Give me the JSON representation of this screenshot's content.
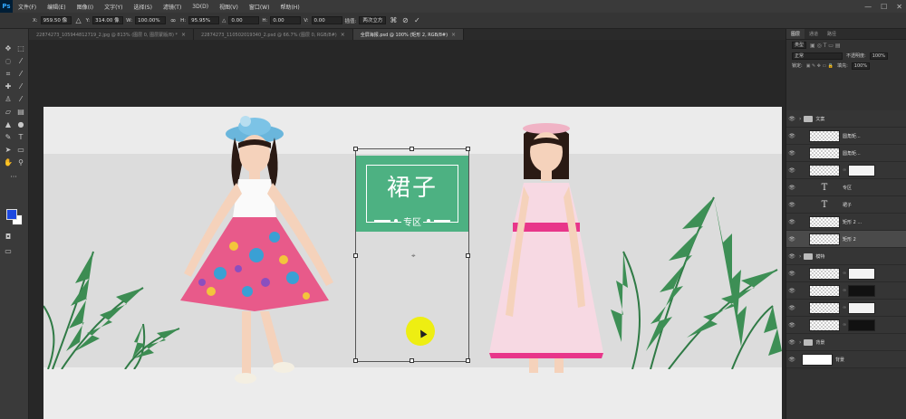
{
  "app": {
    "logo": "Ps",
    "menu": [
      "文件(F)",
      "编辑(E)",
      "图像(I)",
      "文字(Y)",
      "选择(S)",
      "滤镜(T)",
      "3D(D)",
      "视图(V)",
      "窗口(W)",
      "帮助(H)"
    ],
    "window_controls": [
      "—",
      "☐",
      "✕"
    ]
  },
  "options": {
    "x_label": "X:",
    "x_value": "959.50 像",
    "y_label": "Y:",
    "y_value": "314.00 像",
    "w_label": "W:",
    "w_value": "100.00%",
    "h_label": "H:",
    "h_value": "95.95%",
    "angle_label": "△",
    "angle_value": "0.00",
    "hskew_label": "H:",
    "hskew_value": "0.00",
    "vskew_label": "V:",
    "vskew_value": "0.00",
    "interp_label": "插值:",
    "interp_value": "两次立方"
  },
  "tabs": [
    {
      "label": "22874273_105944812719_2.jpg @ 813% (图层 0, 图层蒙版/8) *",
      "active": false
    },
    {
      "label": "22874273_110502019340_2.psd @ 66.7% (图层 0, RGB/8#)",
      "active": false
    },
    {
      "label": "全屏海报.psd @ 100% (矩形 2, RGB/8#)",
      "active": true
    }
  ],
  "tools": [
    "move-icon",
    "marquee-icon",
    "lasso-icon",
    "magic-wand-icon",
    "crop-icon",
    "eyedropper-icon",
    "healing-icon",
    "brush-icon",
    "stamp-icon",
    "history-brush-icon",
    "eraser-icon",
    "gradient-icon",
    "blur-icon",
    "dodge-icon",
    "pen-icon",
    "type-icon",
    "path-select-icon",
    "shape-icon",
    "hand-icon",
    "zoom-icon"
  ],
  "colors": {
    "foreground": "#1c48e0",
    "background": "#ffffff",
    "green_box": "#4db182",
    "cursor_highlight": "#eeee12"
  },
  "poster": {
    "title": "裙子",
    "subtitle": "专区"
  },
  "panels": {
    "tabs": [
      "图层",
      "通道",
      "路径"
    ],
    "filter_label": "类型",
    "blend_mode": "正常",
    "opacity_label": "不透明度:",
    "opacity_value": "100%",
    "lock_label": "锁定:",
    "fill_label": "填充:",
    "fill_value": "100%"
  },
  "layers": [
    {
      "name": "文案",
      "kind": "group",
      "depth": 0
    },
    {
      "name": "圆角矩...",
      "kind": "shape",
      "depth": 1
    },
    {
      "name": "圆角矩...",
      "kind": "shape",
      "depth": 1
    },
    {
      "name": "",
      "kind": "shape-mask",
      "depth": 1
    },
    {
      "name": "专区",
      "kind": "text",
      "depth": 1
    },
    {
      "name": "裙子",
      "kind": "text",
      "depth": 1
    },
    {
      "name": "矩形 2 ...",
      "kind": "shape",
      "depth": 1
    },
    {
      "name": "矩形 2",
      "kind": "shape",
      "depth": 1,
      "selected": true
    },
    {
      "name": "模特",
      "kind": "group",
      "depth": 0
    },
    {
      "name": "",
      "kind": "mask-white",
      "depth": 1
    },
    {
      "name": "",
      "kind": "mask-black",
      "depth": 1
    },
    {
      "name": "",
      "kind": "mask-white",
      "depth": 1
    },
    {
      "name": "",
      "kind": "mask-black",
      "depth": 1
    },
    {
      "name": "背景",
      "kind": "group",
      "depth": 0
    },
    {
      "name": "背景",
      "kind": "background",
      "depth": 0
    }
  ]
}
